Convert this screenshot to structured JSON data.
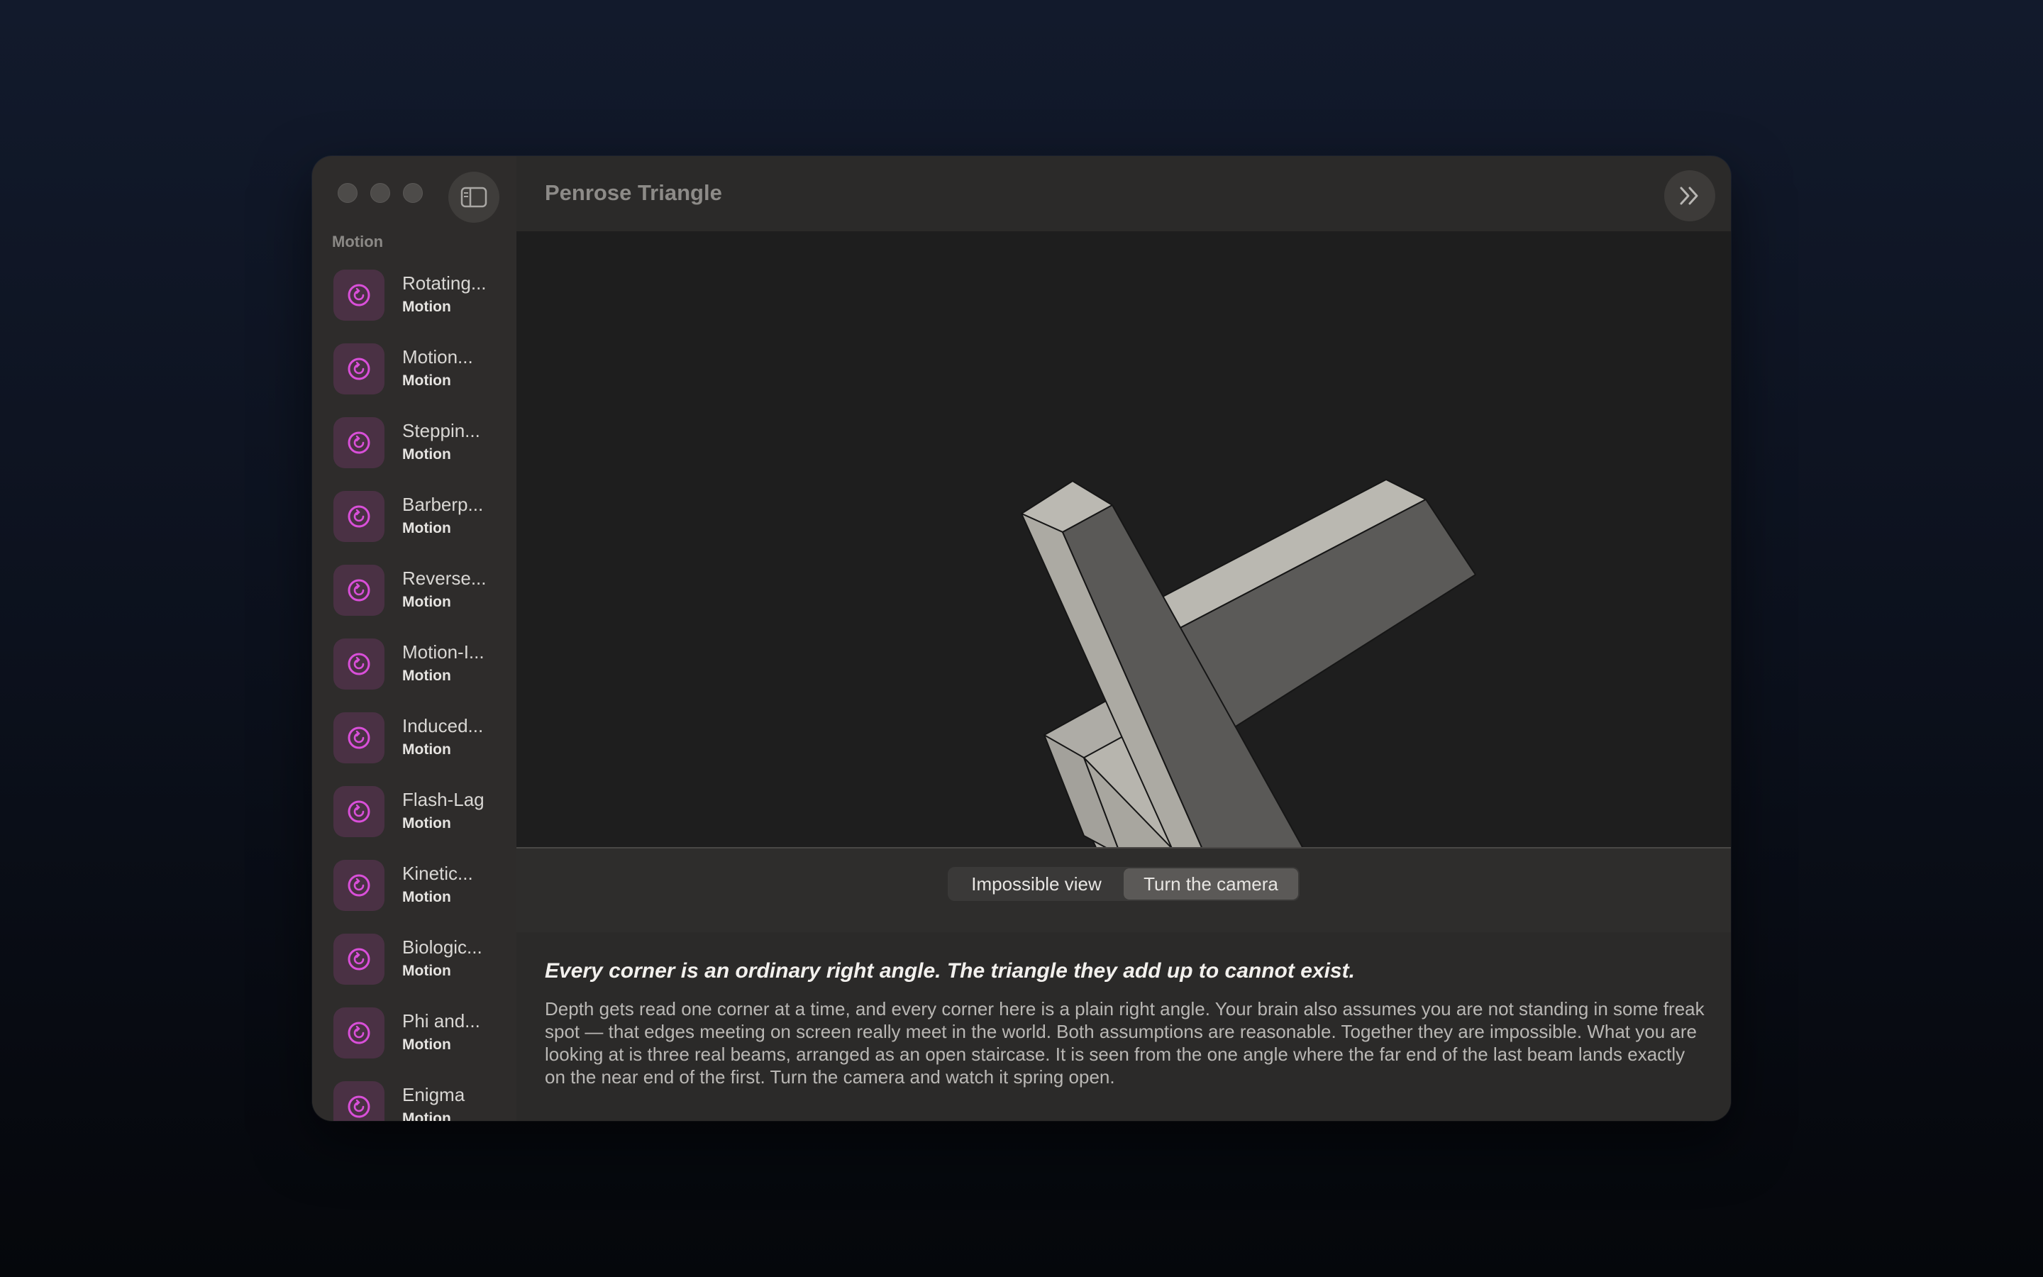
{
  "window": {
    "title": "Penrose Triangle"
  },
  "sidebar": {
    "section_title": "Motion",
    "items": [
      {
        "title": "Rotating...",
        "subtitle": "Motion"
      },
      {
        "title": "Motion...",
        "subtitle": "Motion"
      },
      {
        "title": "Steppin...",
        "subtitle": "Motion"
      },
      {
        "title": "Barberp...",
        "subtitle": "Motion"
      },
      {
        "title": "Reverse...",
        "subtitle": "Motion"
      },
      {
        "title": "Motion-I...",
        "subtitle": "Motion"
      },
      {
        "title": "Induced...",
        "subtitle": "Motion"
      },
      {
        "title": "Flash-Lag",
        "subtitle": "Motion"
      },
      {
        "title": "Kinetic...",
        "subtitle": "Motion"
      },
      {
        "title": "Biologic...",
        "subtitle": "Motion"
      },
      {
        "title": "Phi and...",
        "subtitle": "Motion"
      },
      {
        "title": "Enigma",
        "subtitle": "Motion"
      }
    ]
  },
  "controls": {
    "options": [
      "Impossible view",
      "Turn the camera"
    ],
    "selected": "Turn the camera"
  },
  "description": {
    "headline": "Every corner is an ordinary right angle. The triangle they add up to cannot exist.",
    "body": "Depth gets read one corner at a time, and every corner here is a plain right angle. Your brain also assumes you are not standing in some freak spot — that edges meeting on screen really meet in the world. Both assumptions are reasonable. Together they are impossible. What you are looking at is three real beams, arranged as an open staircase. It is seen from the one angle where the far end of the last beam lands exactly on the near end of the first. Turn the camera and watch it spring open."
  },
  "colors": {
    "accent_icon": "#d94fd9",
    "icon_tile": "#4a3144",
    "beam_light": "#b9b7b0",
    "beam_mid": "#a6a49e",
    "beam_dark": "#595856"
  }
}
